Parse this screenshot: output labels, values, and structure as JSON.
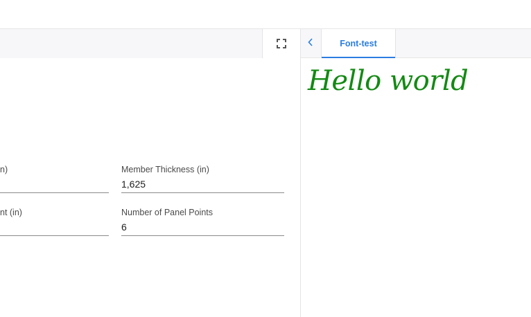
{
  "left_pane": {
    "fields": [
      {
        "label": "n)",
        "value": ""
      },
      {
        "label": "Member Thickness (in)",
        "value": "1,625"
      },
      {
        "label": "nt (in)",
        "value": ""
      },
      {
        "label": "Number of Panel Points",
        "value": "6"
      }
    ]
  },
  "right_pane": {
    "tabs": [
      {
        "label": "Font-test",
        "active": true
      }
    ],
    "preview": {
      "text": "Hello world",
      "color": "#138a13"
    }
  },
  "icons": {
    "fullscreen": "fullscreen-icon",
    "back": "chevron-left-icon"
  },
  "colors": {
    "accent": "#2a7de1",
    "preview_text": "#138a13"
  }
}
